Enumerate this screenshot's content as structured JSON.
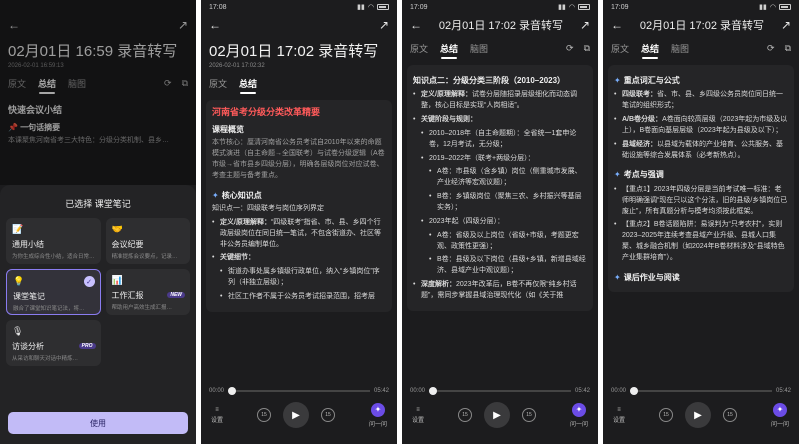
{
  "p1": {
    "title": "02月01日 16:59 录音转写",
    "date": "2026-02-01 16:59:13",
    "tabs": [
      "原文",
      "总结",
      "脑图"
    ],
    "bg_heading": "快速会议小结",
    "bg_sub": "一句话摘要",
    "bg_text": "本课聚焦河南省考三大特色：分级分类机制、县乡…",
    "sheet_title": "已选择 课堂笔记",
    "templates": [
      {
        "name": "通用小结",
        "desc": "为你生成综合性小结，适合日常…",
        "icon": "📝"
      },
      {
        "name": "会议纪要",
        "desc": "精准提炼会议要点，记录…",
        "icon": "🤝"
      },
      {
        "name": "课堂笔记",
        "desc": "融合了课堂知识笔记法，将…",
        "icon": "💡"
      },
      {
        "name": "工作汇报",
        "desc": "帮助用户高效生成汇报…",
        "icon": "📊",
        "badge": "NEW"
      },
      {
        "name": "访谈分析",
        "desc": "从采访和聊天对话中精炼…",
        "icon": "🎙",
        "badge": "PRO"
      }
    ],
    "use_button": "使用"
  },
  "p2": {
    "time": "17:08",
    "title": "02月01日 17:02 录音转写",
    "date": "2026-02-01 17:02:32",
    "tabs": [
      "原文",
      "总结"
    ],
    "heading": "河南省考分级分类改革精要",
    "overview_h": "课程概览",
    "overview": "本节核心：厘清河南省公务员考试自2010年以来的命题模式演进（自主命题→全国联考）与试卷分级逻辑（A卷市级→省市县乡四级分层），明确各层级岗位对应试卷、考查主题与备考重点。",
    "core_h": "核心知识点",
    "kp1": "知识点一：四级联考与岗位序列界定",
    "b1_label": "定义/原理解释：",
    "b1": "“四级联考”指省、市、县、乡四个行政层级岗位在同日统一笔试，不包含街道办、社区等非公务员编制单位。",
    "b2": "关键细节：",
    "s1": "街道办事处属乡镇级行政单位，纳入“乡镇岗位”序列（非独立层级）；",
    "s2": "社区工作者不属于公务员考试招录范围，招考层"
  },
  "p3": {
    "time": "17:09",
    "title": "02月01日 17:02 录音转写",
    "tabs": [
      "原文",
      "总结",
      "脑图"
    ],
    "kp2": "知识点二：分级分类三阶段（2010–2023）",
    "d_label": "定义/原理解释：",
    "d": "试卷分层随招录层级细化而动态调整，核心目标是实现“人岗相适”。",
    "stages_h": "关键阶段与规则：",
    "st1": "2010–2018年（自主命题期）：全省统一1套申论卷，12月考试，无分级；",
    "st2": "2019–2022年（联考+两级分层）：",
    "st2a": "A卷：市县级（含乡镇）岗位（侧重城市发展、产业经济等宏观议题）；",
    "st2b": "B卷：乡镇级岗位（聚焦三农、乡村振兴等基层实务）；",
    "st3": "2023年起（四级分层）：",
    "st3a": "A卷：省级及以上岗位（省级+市级，考题更宏观、政策性更强）；",
    "st3b": "B卷：县级及以下岗位（县级+乡镇，新增县域经济、县域产业中观议题）；",
    "deep_label": "深度解析：",
    "deep": "2023年改革后，B卷不再仅限“纯乡村话题”，需同步掌握县域治理现代化（如《关于推"
  },
  "p4": {
    "time": "17:09",
    "title": "02月01日 17:02 录音转写",
    "tabs": [
      "原文",
      "总结",
      "脑图"
    ],
    "vocab_h": "重点词汇与公式",
    "v1_label": "四级联考：",
    "v1": "省、市、县、乡四级公务员岗位同日统一笔试的组织形式；",
    "v2_label": "A/B卷分级：",
    "v2": "A卷面向较高层级（2023年起为市级及以上），B卷面向基层层级（2023年起为县级及以下）；",
    "v3_label": "县域经济：",
    "v3": "以县域为载体的产业培育、公共服务、基础设施等综合发展体系（必考新热点）。",
    "test_h": "考点与强调",
    "t1": "【重点1】2023年四级分层是当前考试唯一标准：老师明确强调“现在只以这个分法，旧的县级/乡镇岗位已废止”，所有真题分析与模考均须按此框架。",
    "t2": "【重点2】B卷话题陷阱：易误判为“只考农村”，实则2023–2025年连续考查县域产业升级、县城人口集聚、城乡融合机制（如2024年B卷材料涉及“县域特色产业集群培育”）。",
    "hw_h": "课后作业与阅读"
  },
  "player": {
    "cur": "00:00",
    "total": "05:42",
    "settings": "设置",
    "back": "15",
    "fwd": "15",
    "ask": "问一问"
  }
}
